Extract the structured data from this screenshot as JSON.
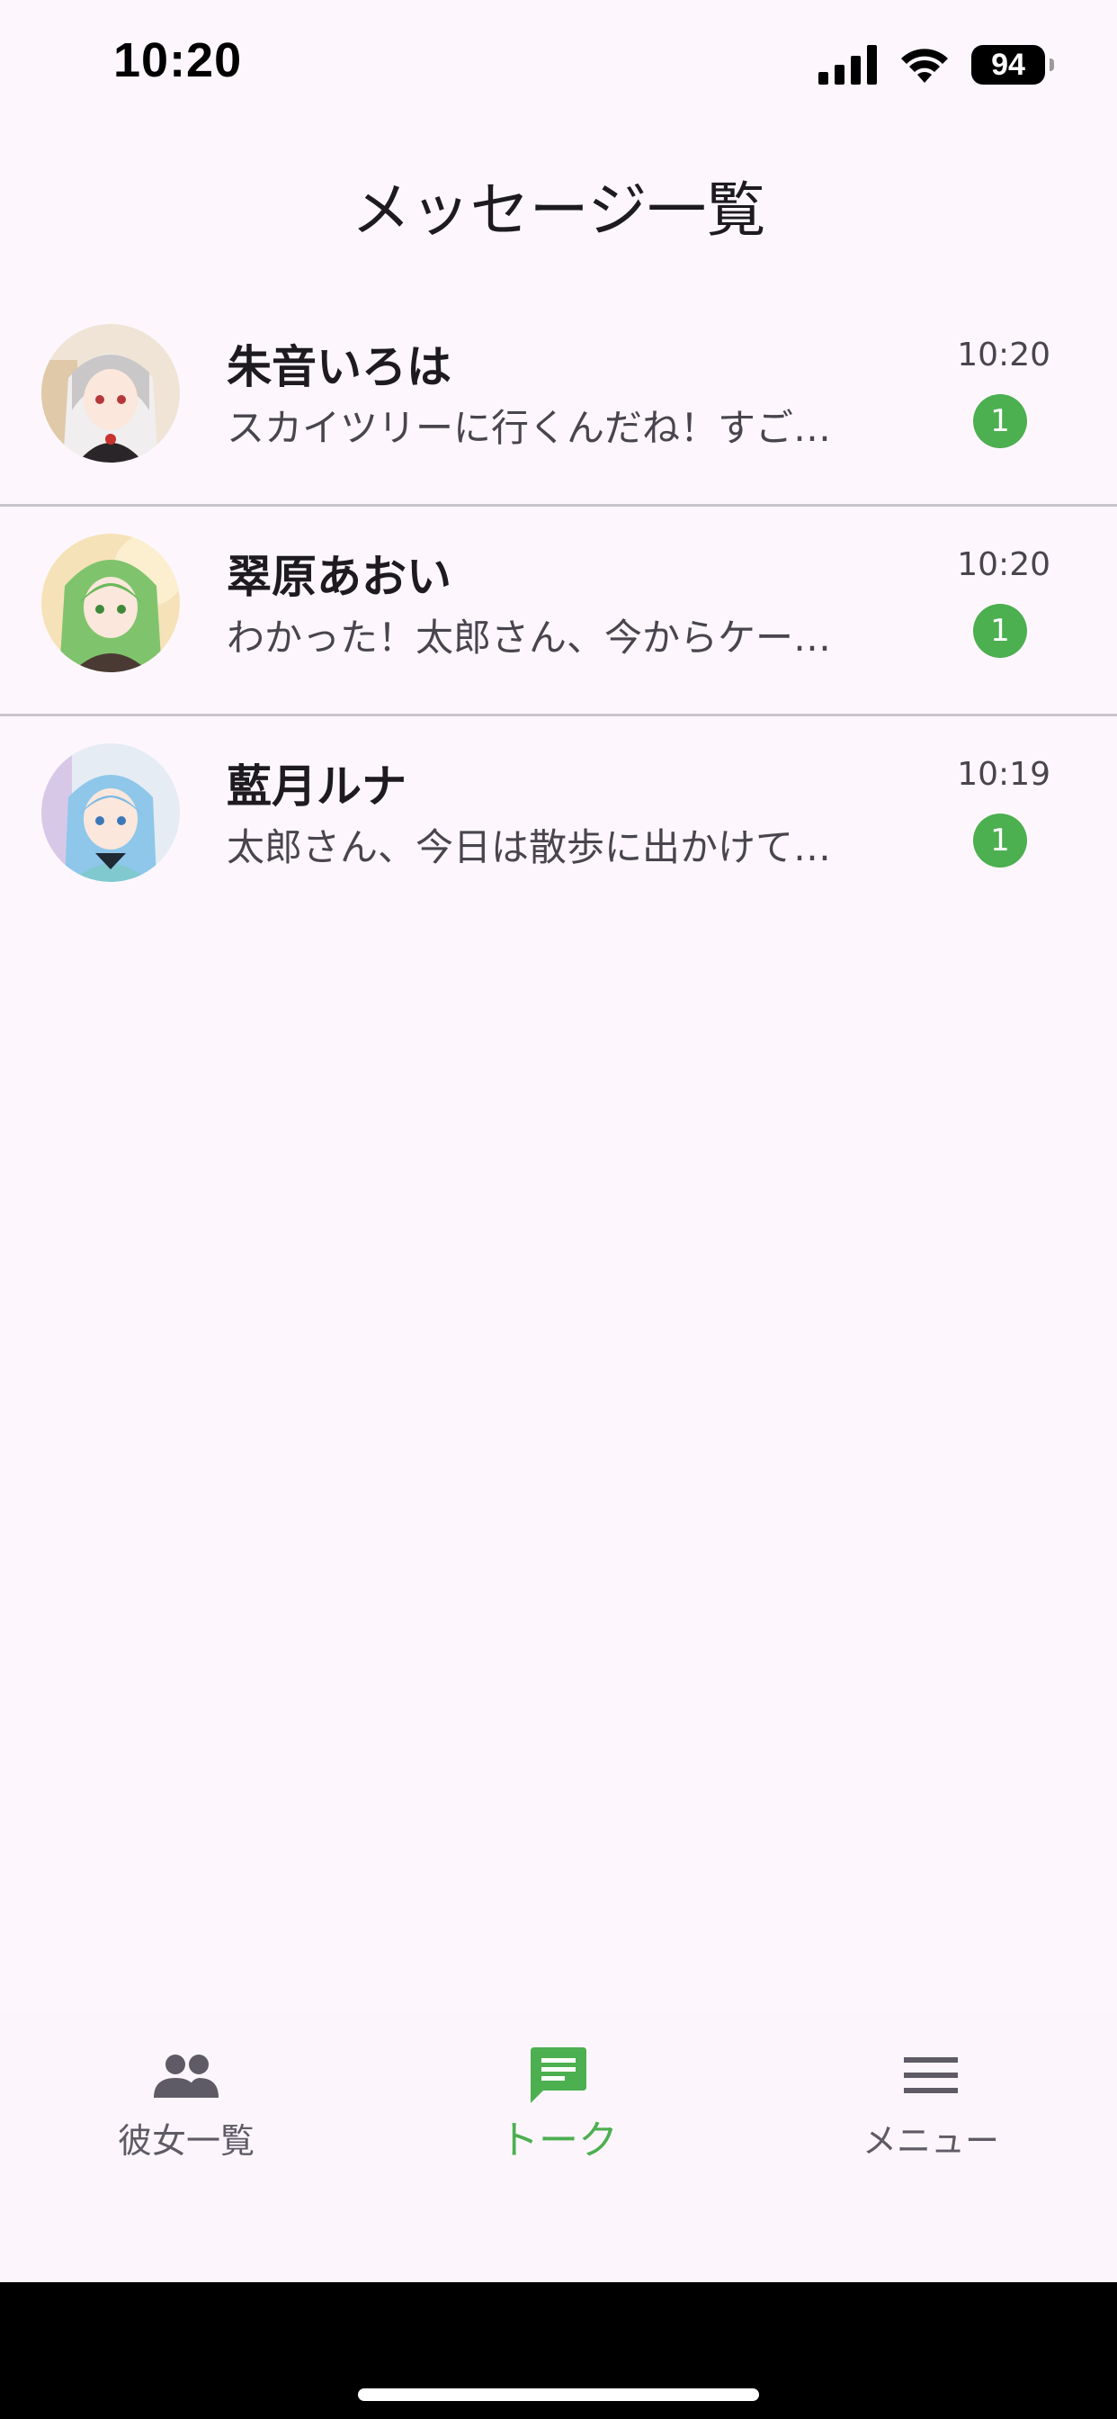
{
  "status_bar": {
    "time": "10:20",
    "battery": "94"
  },
  "header": {
    "title": "メッセージ一覧"
  },
  "chats": [
    {
      "name": "朱音いろは",
      "last_message": "スカイツリーに行くんだね！すご…",
      "time": "10:20",
      "unread": "1"
    },
    {
      "name": "翠原あおい",
      "last_message": "わかった！太郎さん、今からケー…",
      "time": "10:20",
      "unread": "1"
    },
    {
      "name": "藍月ルナ",
      "last_message": "太郎さん、今日は散歩に出かけて…",
      "time": "10:19",
      "unread": "1"
    }
  ],
  "nav": {
    "friends_label": "彼女一覧",
    "talk_label": "トーク",
    "menu_label": "メニュー",
    "friends_icon": "people-icon",
    "talk_icon": "chat-bubble-icon",
    "menu_icon": "hamburger-menu-icon"
  },
  "colors": {
    "accent": "#4CAF50",
    "background": "#FDF7FD",
    "badge": "#4CAF50"
  }
}
